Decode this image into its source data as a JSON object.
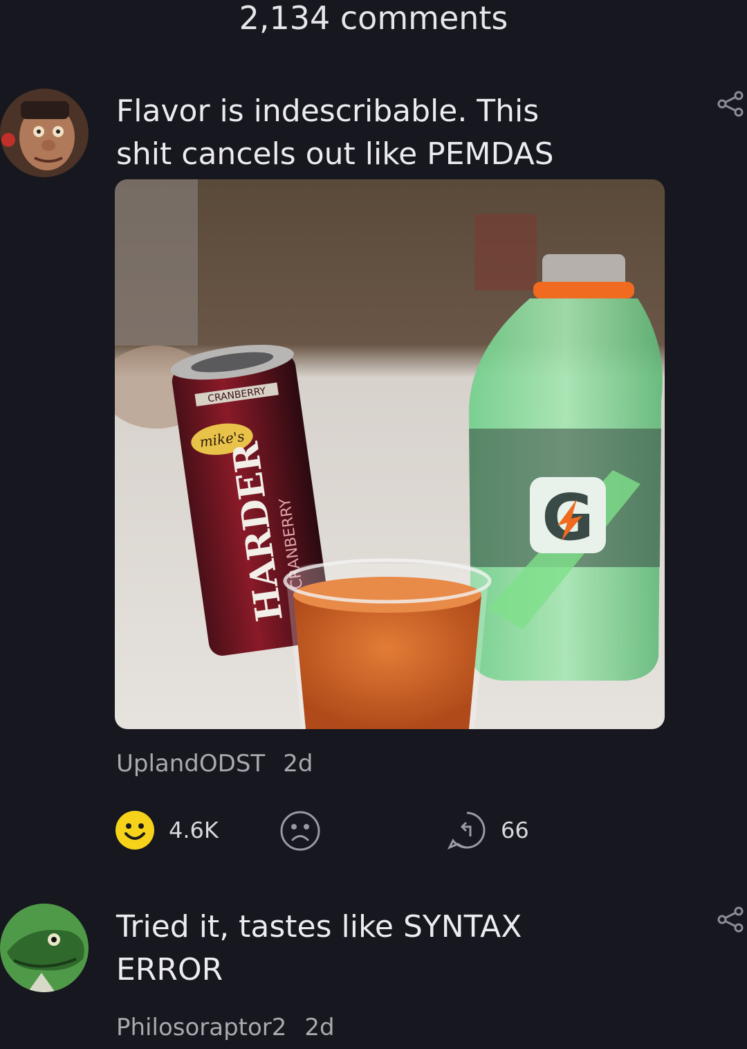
{
  "header": {
    "comment_count": "2,134 comments"
  },
  "comments": [
    {
      "text_line1": "Flavor is indescribable. This",
      "text_line2": "shit cancels out like PEMDAS",
      "image_content": {
        "can_brand": "mike's",
        "can_product": "HARDER",
        "can_flavor": "CRANBERRY",
        "can_flavor_top": "CRANBERRY",
        "bottle_logo": "G"
      },
      "username": "UplandODST",
      "time": "2d",
      "upvotes": "4.6K",
      "replies": "66"
    },
    {
      "text_line1": "Tried it, tastes like SYNTAX",
      "text_line2": "ERROR",
      "username": "Philosoraptor2",
      "time": "2d"
    }
  ],
  "colors": {
    "background": "#16171f",
    "upvote_face": "#f6d21a",
    "text": "#ececf0",
    "muted": "#a9a9b0"
  }
}
